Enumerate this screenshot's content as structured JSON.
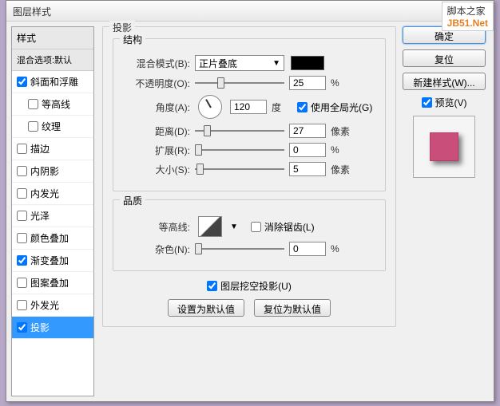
{
  "watermark": {
    "cn": "脚本之家",
    "en": "JB51.Net"
  },
  "title": "图层样式",
  "left": {
    "header": "样式",
    "sub": "混合选项:默认",
    "items": [
      {
        "label": "斜面和浮雕",
        "checked": true,
        "indent": false
      },
      {
        "label": "等高线",
        "checked": false,
        "indent": true
      },
      {
        "label": "纹理",
        "checked": false,
        "indent": true
      },
      {
        "label": "描边",
        "checked": false,
        "indent": false
      },
      {
        "label": "内阴影",
        "checked": false,
        "indent": false
      },
      {
        "label": "内发光",
        "checked": false,
        "indent": false
      },
      {
        "label": "光泽",
        "checked": false,
        "indent": false
      },
      {
        "label": "颜色叠加",
        "checked": false,
        "indent": false
      },
      {
        "label": "渐变叠加",
        "checked": true,
        "indent": false
      },
      {
        "label": "图案叠加",
        "checked": false,
        "indent": false
      },
      {
        "label": "外发光",
        "checked": false,
        "indent": false
      },
      {
        "label": "投影",
        "checked": true,
        "indent": false,
        "selected": true
      }
    ]
  },
  "mid": {
    "title": "投影",
    "struct": {
      "legend": "结构",
      "blendmode_label": "混合模式(B):",
      "blendmode_value": "正片叠底",
      "swatch": "#000000",
      "opacity_label": "不透明度(O):",
      "opacity_value": "25",
      "opacity_unit": "%",
      "angle_label": "角度(A):",
      "angle_value": "120",
      "angle_unit": "度",
      "global_label": "使用全局光(G)",
      "global_checked": true,
      "distance_label": "距离(D):",
      "distance_value": "27",
      "distance_unit": "像素",
      "spread_label": "扩展(R):",
      "spread_value": "0",
      "spread_unit": "%",
      "size_label": "大小(S):",
      "size_value": "5",
      "size_unit": "像素"
    },
    "quality": {
      "legend": "品质",
      "contour_label": "等高线:",
      "antialias_label": "消除锯齿(L)",
      "antialias_checked": false,
      "noise_label": "杂色(N):",
      "noise_value": "0",
      "noise_unit": "%"
    },
    "knockout_label": "图层挖空投影(U)",
    "knockout_checked": true,
    "btn_default": "设置为默认值",
    "btn_reset": "复位为默认值"
  },
  "right": {
    "ok": "确定",
    "reset": "复位",
    "newstyle": "新建样式(W)...",
    "preview_label": "预览(V)",
    "preview_checked": true
  }
}
